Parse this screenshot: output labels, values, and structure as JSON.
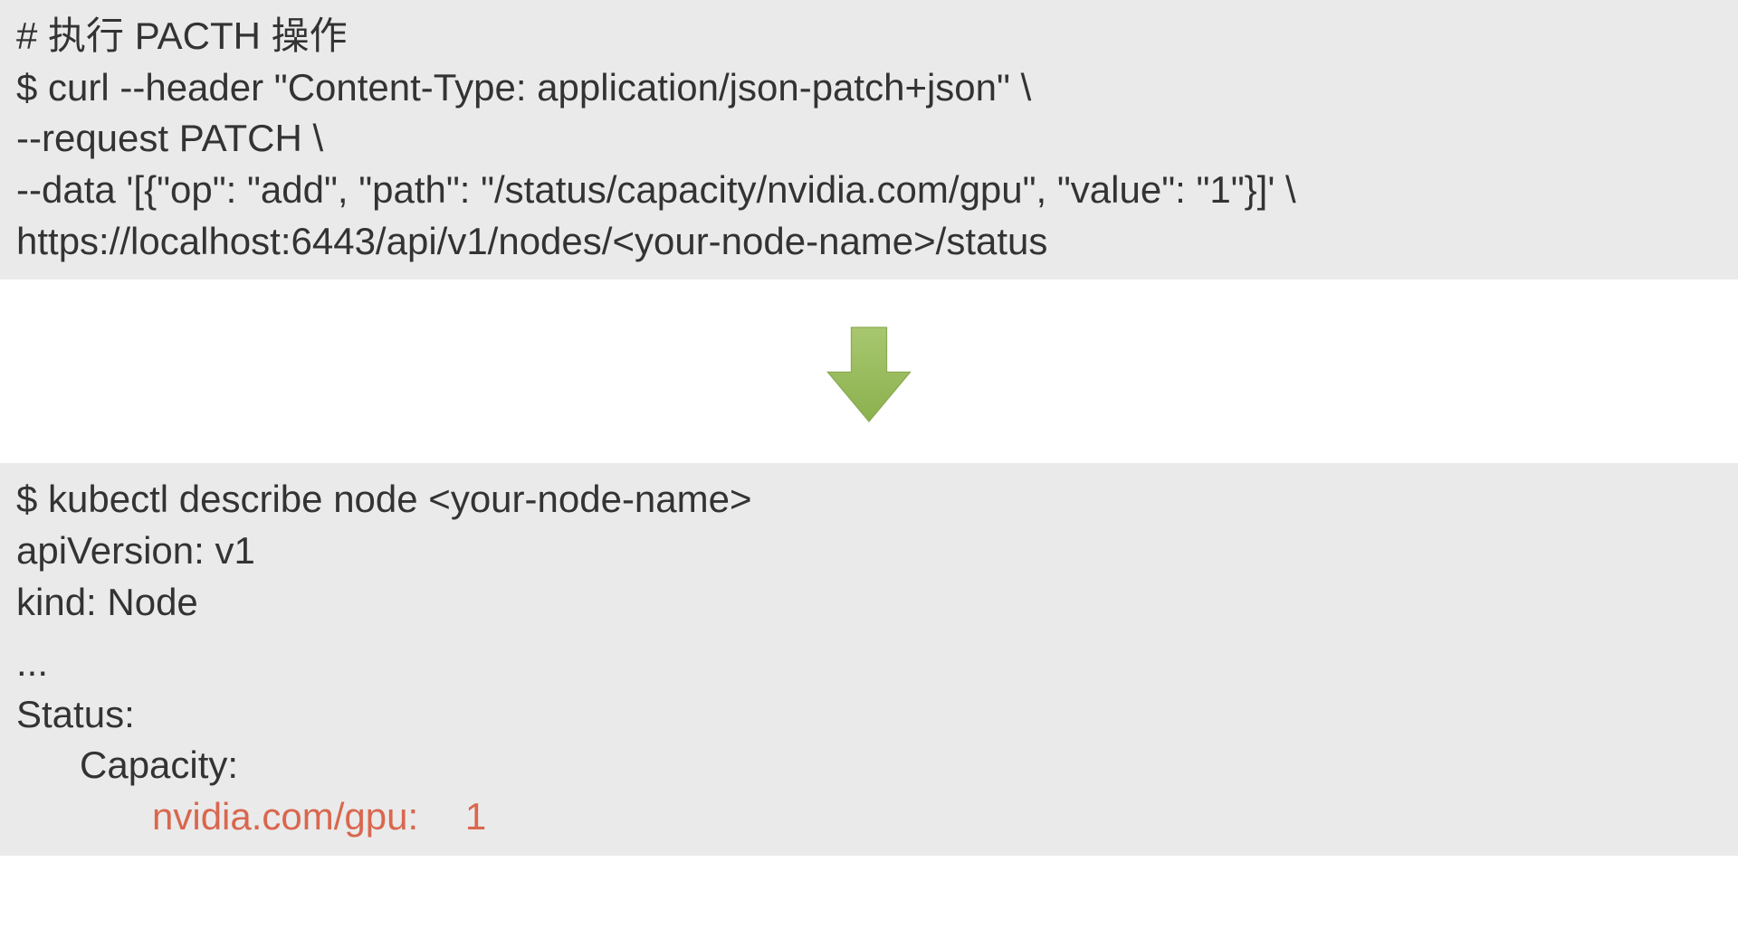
{
  "block1": {
    "line1": "# 执行 PACTH 操作",
    "line2": "$ curl --header \"Content-Type: application/json-patch+json\" \\",
    "line3": "--request PATCH \\",
    "line4": "--data '[{\"op\": \"add\", \"path\": \"/status/capacity/nvidia.com/gpu\", \"value\": \"1\"}]' \\",
    "line5": "https://localhost:6443/api/v1/nodes/<your-node-name>/status"
  },
  "block2": {
    "line1": "$ kubectl describe node <your-node-name>",
    "line2": "apiVersion: v1",
    "line3": "kind: Node",
    "line4": "...",
    "line5": "Status:",
    "line6": "Capacity:",
    "line7a": "nvidia.com/gpu:",
    "line7b": "1"
  }
}
